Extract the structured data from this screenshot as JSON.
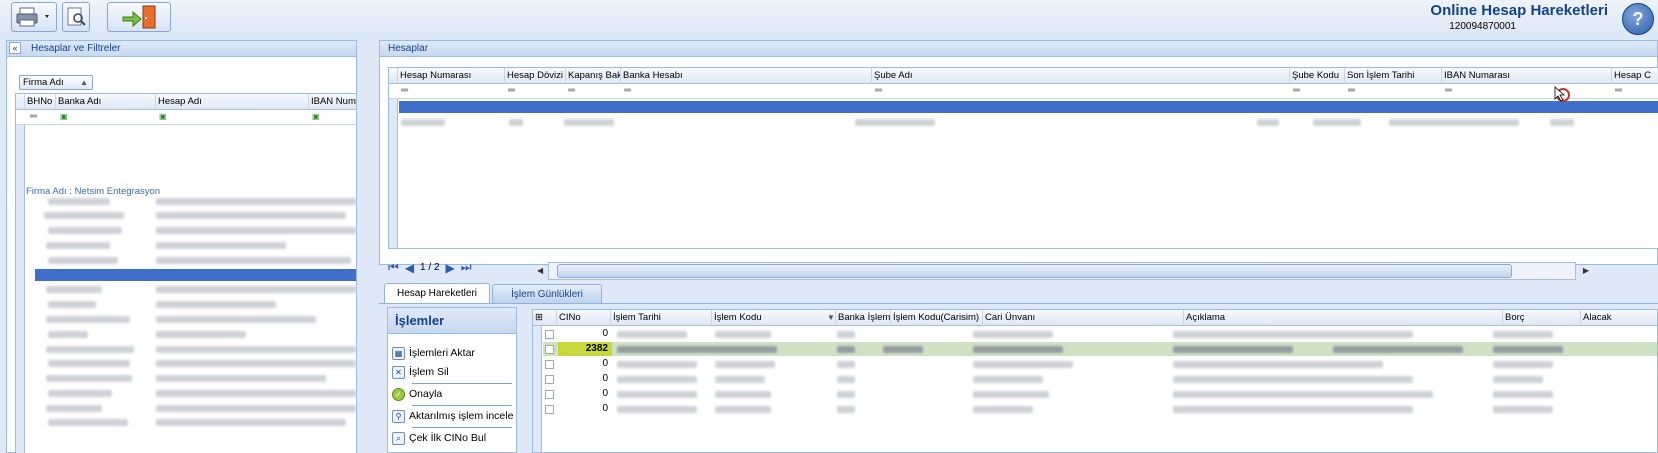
{
  "header": {
    "title": "Online Hesap Hareketleri",
    "subtitle": "120094870001",
    "help_label": "?"
  },
  "left_panel": {
    "title": "Hesaplar ve Filtreler",
    "group_field": "Firma Adı",
    "columns": [
      "BHNo",
      "Banka Adı",
      "Hesap Adı",
      "IBAN Numa"
    ],
    "group_row": "Firma Adı : Netsim Entegrasyon"
  },
  "accounts_panel": {
    "title": "Hesaplar",
    "columns": [
      "Hesap Numarası",
      "Hesap Dövizi",
      "Kapanış Baki",
      "Banka Hesabı",
      "Şube Adı",
      "Şube Kodu",
      "Son İşlem Tarihi",
      "IBAN Numarası",
      "Hesap C"
    ],
    "pager": "1 / 2"
  },
  "tabs": [
    {
      "label": "Hesap Hareketleri",
      "active": true
    },
    {
      "label": "İşlem Günlükleri",
      "active": false
    }
  ],
  "operations": {
    "title": "İşlemler",
    "items": [
      "İşlemleri Aktar",
      "İşlem Sil",
      "Onayla",
      "Aktarılmış işlem incele",
      "Çek İlk CINo Bul"
    ]
  },
  "transactions": {
    "columns": [
      "CINo",
      "İşlem Tarihi",
      "İşlem Kodu",
      "Banka İşlemi",
      "İşlem Kodu(Carisim)",
      "Cari Ünvanı",
      "Açıklama",
      "Borç",
      "Alacak"
    ],
    "cino_values": [
      "0",
      "2382",
      "0",
      "0",
      "0",
      "0"
    ]
  },
  "colors": {
    "accent": "#15428b",
    "selection": "#3f6fc9",
    "highlight_cell": "#c8d83a"
  }
}
